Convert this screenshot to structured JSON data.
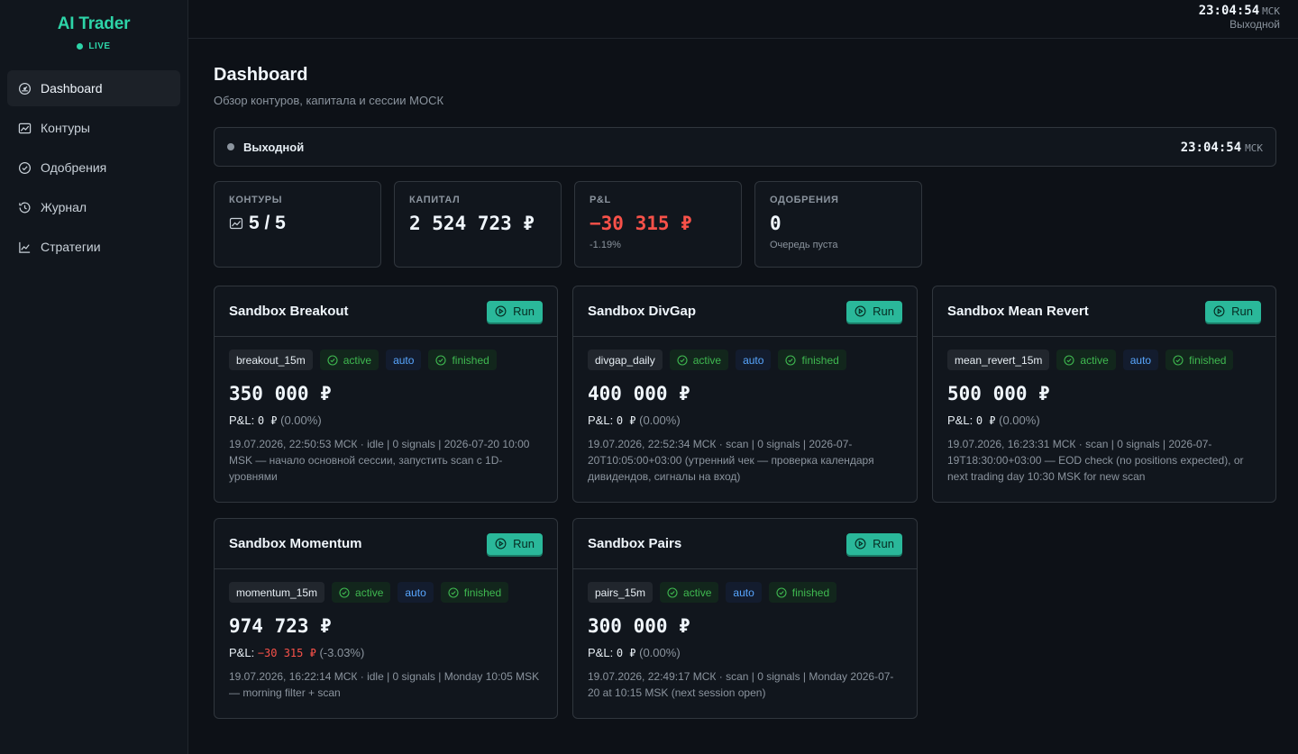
{
  "brand": {
    "title": "AI Trader",
    "live": "LIVE"
  },
  "nav": [
    {
      "label": "Dashboard",
      "icon": "gauge-icon",
      "active": true
    },
    {
      "label": "Контуры",
      "icon": "chart-line-icon"
    },
    {
      "label": "Одобрения",
      "icon": "check-circle-icon"
    },
    {
      "label": "Журнал",
      "icon": "history-icon"
    },
    {
      "label": "Стратегии",
      "icon": "trend-icon"
    }
  ],
  "topbar": {
    "time": "23:04:54",
    "tz": "МСК",
    "session": "Выходной"
  },
  "page": {
    "title": "Dashboard",
    "subtitle": "Обзор контуров, капитала и сессии МОСК"
  },
  "session_bar": {
    "status": "Выходной",
    "time": "23:04:54",
    "tz": "МСК"
  },
  "stats": {
    "contours": {
      "label": "КОНТУРЫ",
      "value": "5 / 5"
    },
    "capital": {
      "label": "КАПИТАЛ",
      "value": "2 524 723 ₽"
    },
    "pnl": {
      "label": "P&L",
      "value": "−30 315 ₽",
      "sub": "-1.19%"
    },
    "approvals": {
      "label": "ОДОБРЕНИЯ",
      "value": "0",
      "sub": "Очередь пуста"
    }
  },
  "run_label": "Run",
  "pnl_label": "P&L:",
  "cards": [
    {
      "title": "Sandbox Breakout",
      "id": "breakout_15m",
      "status": "active",
      "mode": "auto",
      "state": "finished",
      "capital": "350 000 ₽",
      "pnl": "0 ₽",
      "pnl_pct": "(0.00%)",
      "negative": false,
      "note": "19.07.2026, 22:50:53 МСК · idle | 0 signals | 2026-07-20 10:00 MSK — начало основной сессии, запустить scan с 1D-уровнями"
    },
    {
      "title": "Sandbox DivGap",
      "id": "divgap_daily",
      "status": "active",
      "mode": "auto",
      "state": "finished",
      "capital": "400 000 ₽",
      "pnl": "0 ₽",
      "pnl_pct": "(0.00%)",
      "negative": false,
      "note": "19.07.2026, 22:52:34 МСК · scan | 0 signals | 2026-07-20T10:05:00+03:00 (утренний чек — проверка календаря дивидендов, сигналы на вход)"
    },
    {
      "title": "Sandbox Mean Revert",
      "id": "mean_revert_15m",
      "status": "active",
      "mode": "auto",
      "state": "finished",
      "capital": "500 000 ₽",
      "pnl": "0 ₽",
      "pnl_pct": "(0.00%)",
      "negative": false,
      "note": "19.07.2026, 16:23:31 МСК · scan | 0 signals | 2026-07-19T18:30:00+03:00 — EOD check (no positions expected), or next trading day 10:30 MSK for new scan"
    },
    {
      "title": "Sandbox Momentum",
      "id": "momentum_15m",
      "status": "active",
      "mode": "auto",
      "state": "finished",
      "capital": "974 723 ₽",
      "pnl": "−30 315 ₽",
      "pnl_pct": "(-3.03%)",
      "negative": true,
      "note": "19.07.2026, 16:22:14 МСК · idle | 0 signals | Monday 10:05 MSK — morning filter + scan"
    },
    {
      "title": "Sandbox Pairs",
      "id": "pairs_15m",
      "status": "active",
      "mode": "auto",
      "state": "finished",
      "capital": "300 000 ₽",
      "pnl": "0 ₽",
      "pnl_pct": "(0.00%)",
      "negative": false,
      "note": "19.07.2026, 22:49:17 МСК · scan | 0 signals | Monday 2026-07-20 at 10:15 MSK (next session open)"
    }
  ],
  "colors": {
    "accent": "#2dd4a8",
    "negative": "#f85149",
    "positive": "#3fb950",
    "info": "#58a6ff",
    "background": "#0d1117"
  }
}
